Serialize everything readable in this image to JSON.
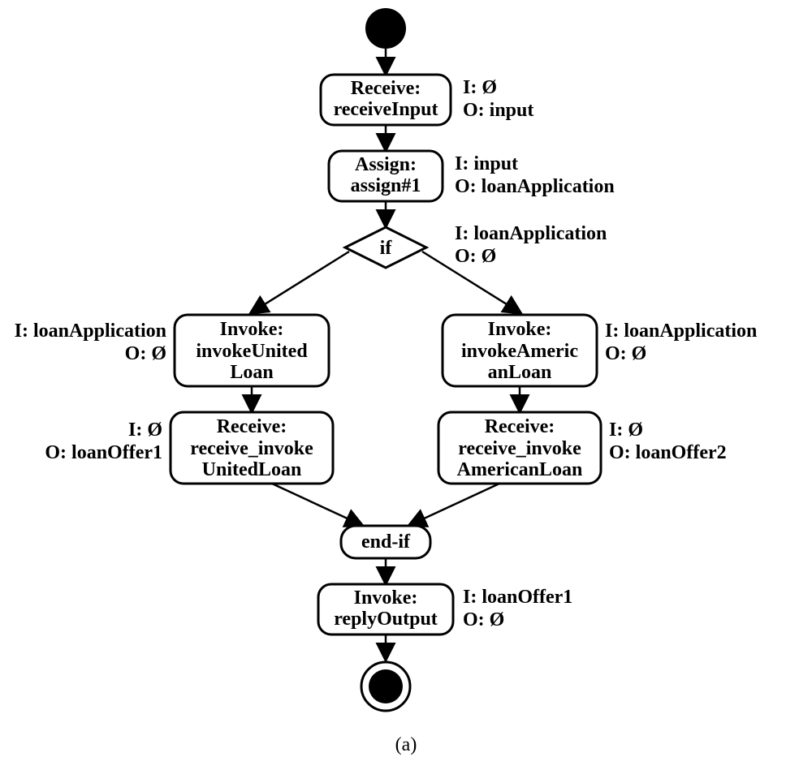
{
  "nodes": {
    "receive_input": {
      "line1": "Receive:",
      "line2": "receiveInput"
    },
    "assign1": {
      "line1": "Assign:",
      "line2": "assign#1"
    },
    "if_node": {
      "label": "if"
    },
    "invoke_united": {
      "line1": "Invoke:",
      "line2": "invokeUnited",
      "line3": "Loan"
    },
    "invoke_american": {
      "line1": "Invoke:",
      "line2": "invokeAmeric",
      "line3": "anLoan"
    },
    "receive_united": {
      "line1": "Receive:",
      "line2": "receive_invoke",
      "line3": "UnitedLoan"
    },
    "receive_american": {
      "line1": "Receive:",
      "line2": "receive_invoke",
      "line3": "AmericanLoan"
    },
    "endif": {
      "label": "end-if"
    },
    "reply": {
      "line1": "Invoke:",
      "line2": "replyOutput"
    }
  },
  "io": {
    "receive_input": {
      "I": "I: Ø",
      "O": "O: input"
    },
    "assign1": {
      "I": "I: input",
      "O": "O: loanApplication"
    },
    "if_node": {
      "I": "I: loanApplication",
      "O": "O: Ø"
    },
    "invoke_united": {
      "I": "I: loanApplication",
      "O": "O: Ø"
    },
    "invoke_american": {
      "I": "I: loanApplication",
      "O": "O: Ø"
    },
    "receive_united": {
      "I": "I: Ø",
      "O": "O: loanOffer1"
    },
    "receive_american": {
      "I": "I: Ø",
      "O": "O: loanOffer2"
    },
    "reply": {
      "I": "I: loanOffer1",
      "O": "O: Ø"
    }
  },
  "caption": "(a)"
}
